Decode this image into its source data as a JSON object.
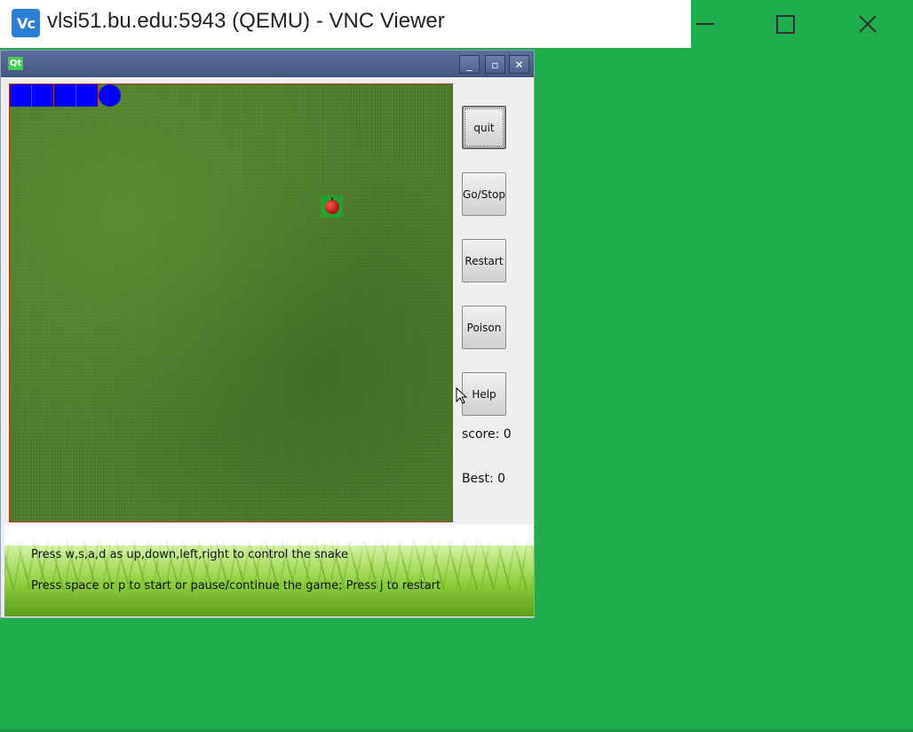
{
  "vnc": {
    "logo_text": "Vc",
    "title": "vlsi51.bu.edu:5943 (QEMU) - VNC Viewer",
    "minimize_icon": "minimize-icon",
    "maximize_icon": "maximize-icon",
    "close_icon": "close-icon"
  },
  "qt_window": {
    "logo_text": "Qt",
    "min_label": "_",
    "max_label": "▫",
    "close_label": "✕"
  },
  "game": {
    "snake_length": 5,
    "food_icon": "apple-icon",
    "colors": {
      "snake": "#0000ff",
      "food_bg": "#1fa32a",
      "board_border": "#b53a16",
      "desktop": "#21ad4d"
    }
  },
  "buttons": {
    "quit": "quit",
    "go_stop": "Go/Stop",
    "restart": "Restart",
    "poison": "Poison",
    "help": "Help"
  },
  "score": {
    "score_text": "score: 0",
    "best_text": "Best: 0"
  },
  "instructions": {
    "line1": "Press w,s,a,d as up,down,left,right to control the snake",
    "line2": "Press space or p to start or pause/continue the game; Press j to restart"
  }
}
